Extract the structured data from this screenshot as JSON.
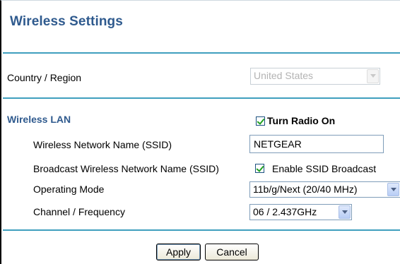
{
  "page": {
    "title": "Wireless Settings"
  },
  "region": {
    "label": "Country / Region",
    "value": "United States",
    "disabled": true
  },
  "wireless_lan": {
    "heading": "Wireless LAN",
    "radio": {
      "label": "Turn Radio On",
      "checked": true
    },
    "ssid": {
      "label": "Wireless Network Name (SSID)",
      "value": "NETGEAR"
    },
    "broadcast": {
      "label": "Broadcast Wireless Network Name (SSID)",
      "checkbox_label": "Enable SSID Broadcast",
      "checked": true
    },
    "mode": {
      "label": "Operating Mode",
      "value": "11b/g/Next (20/40 MHz)"
    },
    "channel": {
      "label": "Channel / Frequency",
      "value": "06 / 2.437GHz"
    }
  },
  "buttons": {
    "apply": "Apply",
    "cancel": "Cancel"
  }
}
